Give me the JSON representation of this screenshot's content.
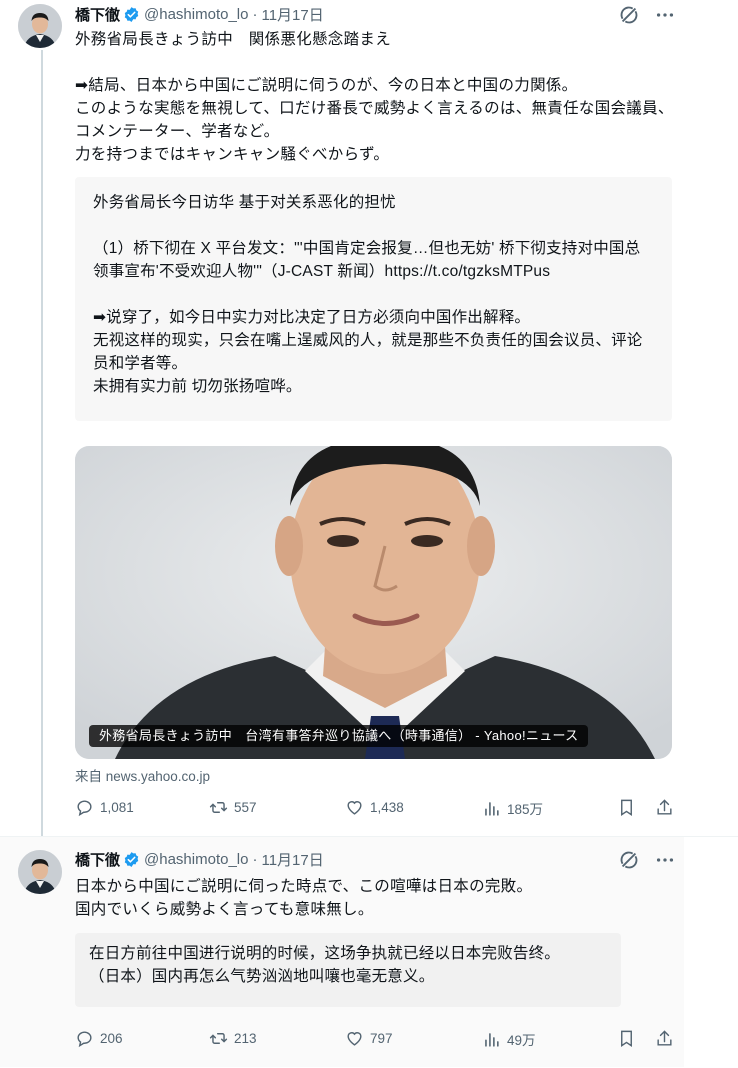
{
  "tweet1": {
    "author_name": "橋下徹",
    "handle": "@hashimoto_lo",
    "date": "11月17日",
    "text": "外務省局長きょう訪中　関係悪化懸念踏まえ\n\n➡結局、日本から中国にご説明に伺うのが、今の日本と中国の力関係。\nこのような実態を無視して、口だけ番長で威勢よく言えるのは、無責任な国会議員、コメンテーター、学者など。\n力を持つまではキャンキャン騒ぐべからず。",
    "translation": "外务省局长今日访华 基于对关系恶化的担忧\n\n（1）桥下彻在 X 平台发文：\"'中国肯定会报复…但也无妨' 桥下彻支持对中国总领事宣布'不受欢迎人物'\"（J-CAST 新闻）https://t.co/tgzksMTPus\n\n➡说穿了，如今日中实力对比决定了日方必须向中国作出解释。\n无视这样的现实，只会在嘴上逞威风的人，就是那些不负责任的国会议员、评论员和学者等。\n未拥有实力前 切勿张扬喧哗。",
    "card_caption": "外務省局長きょう訪中　台湾有事答弁巡り協議へ（時事通信） - Yahoo!ニュース",
    "source": "来自 news.yahoo.co.jp",
    "stats": {
      "replies": "1,081",
      "reposts": "557",
      "likes": "1,438",
      "views": "185万"
    }
  },
  "tweet2": {
    "author_name": "橋下徹",
    "handle": "@hashimoto_lo",
    "date": "11月17日",
    "text": "日本から中国にご説明に伺った時点で、この喧嘩は日本の完敗。\n国内でいくら威勢よく言っても意味無し。",
    "translation": "在日方前往中国进行说明的时候，这场争执就已经以日本完败告终。\n（日本）国内再怎么气势汹汹地叫嚷也毫无意义。",
    "stats": {
      "replies": "206",
      "reposts": "213",
      "likes": "797",
      "views": "49万"
    }
  },
  "icons": [
    "verified-badge-icon",
    "grok-icon",
    "more-icon",
    "reply-icon",
    "repost-icon",
    "like-icon",
    "views-icon",
    "bookmark-icon",
    "share-icon"
  ],
  "colors": {
    "verified": "#1d9bf0",
    "muted": "#536471",
    "thread_line": "#cfd9de",
    "quote_bg": "#f7f7f7"
  }
}
